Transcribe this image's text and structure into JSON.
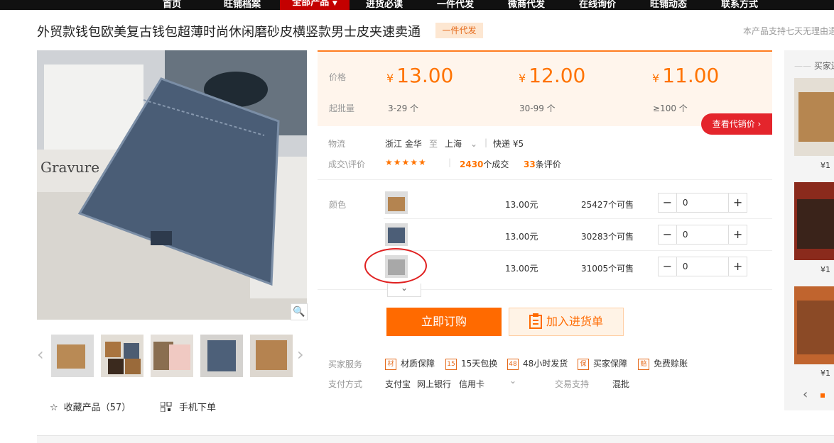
{
  "nav": {
    "items": [
      "首页",
      "旺铺档案",
      "全部产品",
      "进货必读",
      "一件代发",
      "微商代发",
      "在线询价",
      "旺铺动态",
      "联系方式"
    ],
    "active_index": 2,
    "active_arrow": "▼"
  },
  "product": {
    "title": "外贸款钱包欧美复古钱包超薄时尚休闲磨砂皮横竖款男士皮夹速卖通",
    "badge": "一件代发",
    "note": "本产品支持七天无理由退"
  },
  "gallery": {
    "zoom_icon": "🔍",
    "prev": "‹",
    "next": "›"
  },
  "favorite": {
    "icon": "☆",
    "label": "收藏产品（57）"
  },
  "mobile_order": {
    "label": "手机下单"
  },
  "pricing": {
    "price_label": "价格",
    "moq_label": "起批量",
    "currency": "¥",
    "tiers": [
      {
        "price": "13.00",
        "qty": "3-29 个"
      },
      {
        "price": "12.00",
        "qty": "30-99 个"
      },
      {
        "price": "11.00",
        "qty": "≥100 个"
      }
    ],
    "agent_button": "查看代销价 ›"
  },
  "logistics": {
    "label": "物流",
    "from": "浙江 金华",
    "to_word": "至",
    "to": "上海",
    "method": "快递 ¥5"
  },
  "deals": {
    "label": "成交\\评价",
    "stars": "★★★★★",
    "deals_count": "2430",
    "deals_suffix": "个成交",
    "reviews_count": "33",
    "reviews_suffix": "条评价"
  },
  "colors": {
    "label": "颜色",
    "rows": [
      {
        "price": "13.00元",
        "stock": "25427个可售",
        "qty": "0"
      },
      {
        "price": "13.00元",
        "stock": "30283个可售",
        "qty": "0"
      },
      {
        "price": "13.00元",
        "stock": "31005个可售",
        "qty": "0"
      }
    ],
    "expand": "⌄"
  },
  "buttons": {
    "order": "立即订购",
    "cart": "加入进货单"
  },
  "services": {
    "label": "买家服务",
    "items": [
      {
        "icon": "材",
        "label": "材质保障"
      },
      {
        "icon": "15",
        "label": "15天包换"
      },
      {
        "icon": "48",
        "label": "48小时发货"
      },
      {
        "icon": "保",
        "label": "买家保障"
      },
      {
        "icon": "赔",
        "label": "免费赊账"
      }
    ]
  },
  "payment": {
    "label": "支付方式",
    "items": [
      "支付宝",
      "网上银行",
      "信用卡"
    ],
    "support_label": "交易支持",
    "support_value": "混批"
  },
  "right_panel": {
    "title": "买家还",
    "prices": [
      "¥1",
      "¥1",
      "¥1"
    ]
  },
  "colors_theme": {
    "accent": "#ff7300",
    "nav_bg": "#111111",
    "nav_active": "#c40000",
    "agent_btn": "#e4252c"
  }
}
